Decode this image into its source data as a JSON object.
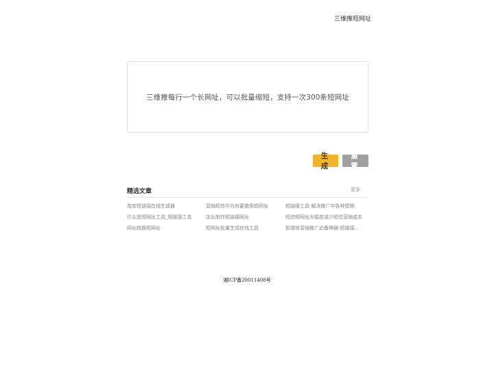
{
  "header": {
    "site_link": "三维推短网址"
  },
  "input": {
    "placeholder": "三维推每行一个长网址，可以批量缩短，支持一次300条短网址"
  },
  "buttons": {
    "generate": "生成",
    "reset": "重置"
  },
  "featured": {
    "title": "精选文章",
    "more": "更多",
    "articles": [
      "淘宝短链接在线生成器",
      "营销短信中为何要使用短网址",
      "短链接工具-解决推广中各种受限",
      "什么是短网址工具_短链接工具",
      "怎么制作短链接网址",
      "短信短网址大幅度减少短信营销成本",
      "网址转换短网址",
      "短网址批量生成在线工具",
      "新媒体营销推广必备神器-短链接..."
    ]
  },
  "footer": {
    "icp": "湘ICP备20011408号"
  }
}
